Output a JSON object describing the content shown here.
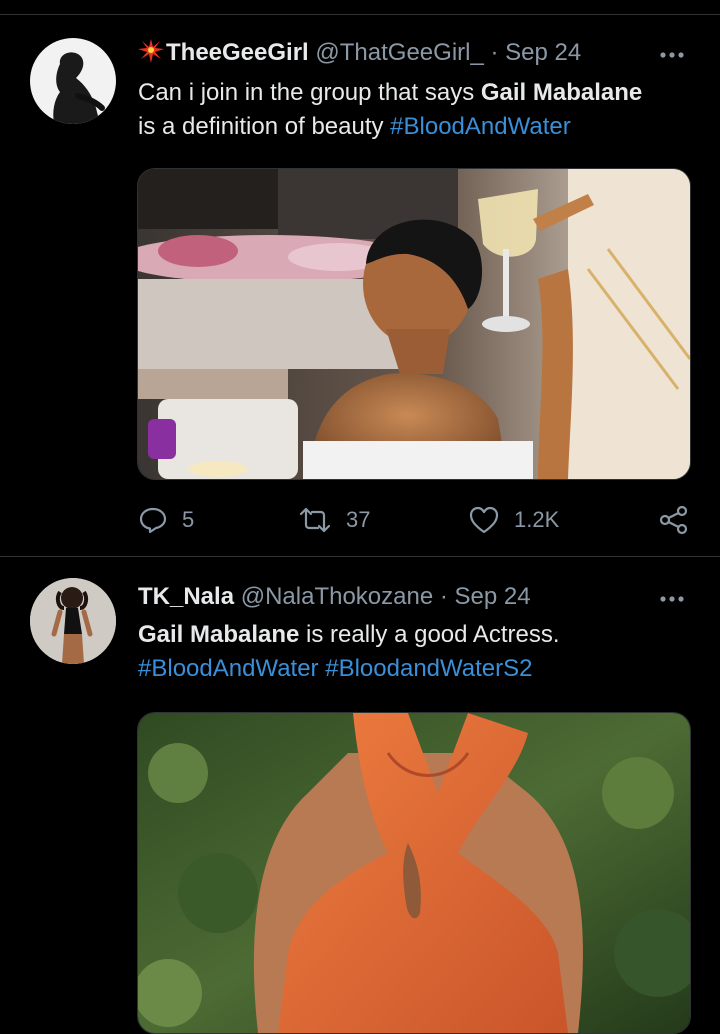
{
  "tweets": [
    {
      "display_name": "TheeGeeGirl",
      "handle": "@ThatGeeGirl_",
      "separator": "·",
      "date": "Sep 24",
      "text_parts": [
        "Can i join in the group that says ",
        "Gail Mabalane",
        " is a definition of beauty ",
        "#BloodAndWater"
      ],
      "replies": "5",
      "retweets": "37",
      "likes": "1.2K",
      "badge_icon": "star-burst-icon"
    },
    {
      "display_name": "TK_Nala",
      "handle": "@NalaThokozane",
      "separator": "·",
      "date": "Sep 24",
      "text_parts": [
        "Gail Mabalane",
        " is really a good Actress.",
        "#BloodAndWater",
        "#BloodandWaterS2"
      ]
    }
  ],
  "colors": {
    "background": "#000000",
    "text": "#e7e9ea",
    "secondary": "#8b98a5",
    "link": "#3a8fd8",
    "divider": "#2f3336"
  }
}
